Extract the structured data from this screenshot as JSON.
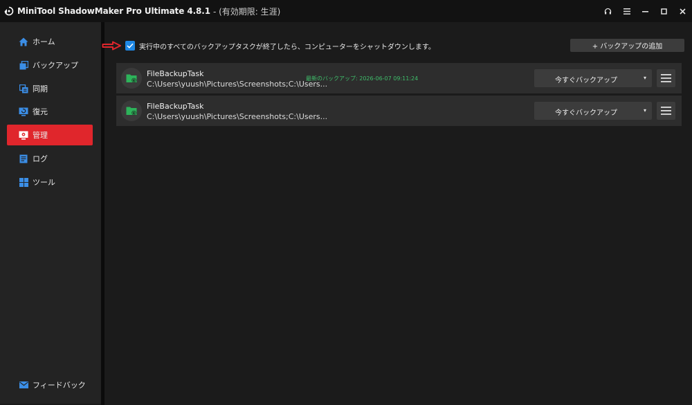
{
  "window": {
    "title": "MiniTool ShadowMaker Pro Ultimate 4.8.1",
    "edition": "- (有効期限: 生涯)"
  },
  "window_controls": [
    "headset-icon",
    "menu-icon",
    "minimize-icon",
    "maximize-icon",
    "close-icon"
  ],
  "sidebar": {
    "items": [
      {
        "label": "ホーム",
        "icon": "home-icon"
      },
      {
        "label": "バックアップ",
        "icon": "backup-icon"
      },
      {
        "label": "同期",
        "icon": "sync-icon"
      },
      {
        "label": "復元",
        "icon": "restore-icon"
      },
      {
        "label": "管理",
        "icon": "manage-icon",
        "active": true
      },
      {
        "label": "ログ",
        "icon": "log-icon"
      },
      {
        "label": "ツール",
        "icon": "tools-icon"
      }
    ],
    "feedback": {
      "label": "フィードバック",
      "icon": "mail-icon"
    }
  },
  "main": {
    "shutdown_option": {
      "label": "実行中のすべてのバックアップタスクが終了したら、コンピューターをシャットダウンします。",
      "checked": true
    },
    "add_backup_label": "+ バックアップの追加",
    "tasks": [
      {
        "name": "FileBackupTask",
        "path": "C:\\Users\\yuush\\Pictures\\Screenshots;C:\\Users...",
        "last_backup": "最新のバックアップ: 2026-06-07 09:11:24",
        "action_label": "今すぐバックアップ",
        "caret": "▾"
      },
      {
        "name": "FileBackupTask",
        "path": "C:\\Users\\yuush\\Pictures\\Screenshots;C:\\Users...",
        "last_backup": "",
        "action_label": "今すぐバックアップ",
        "caret": "▾"
      }
    ]
  },
  "colors": {
    "accent_active": "#e0262c",
    "icon_blue": "#3b8ee6",
    "success_green": "#3fbf6b",
    "checkbox_blue": "#1e88e5"
  }
}
